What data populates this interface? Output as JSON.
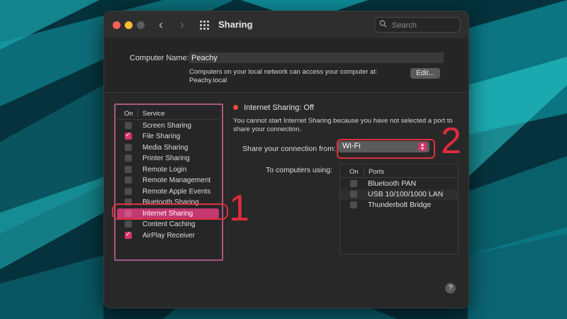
{
  "window": {
    "title": "Sharing",
    "search_placeholder": "Search"
  },
  "computer_name": {
    "label": "Computer Name:",
    "value": "Peachy",
    "description_line1": "Computers on your local network can access your computer at:",
    "description_line2": "Peachy.local",
    "edit_button": "Edit..."
  },
  "services": {
    "header_on": "On",
    "header_service": "Service",
    "items": [
      {
        "label": "Screen Sharing",
        "checked": false
      },
      {
        "label": "File Sharing",
        "checked": true
      },
      {
        "label": "Media Sharing",
        "checked": false
      },
      {
        "label": "Printer Sharing",
        "checked": false
      },
      {
        "label": "Remote Login",
        "checked": false
      },
      {
        "label": "Remote Management",
        "checked": false
      },
      {
        "label": "Remote Apple Events",
        "checked": false
      },
      {
        "label": "Bluetooth Sharing",
        "checked": false
      },
      {
        "label": "Internet Sharing",
        "checked": false,
        "selected": true
      },
      {
        "label": "Content Caching",
        "checked": false
      },
      {
        "label": "AirPlay Receiver",
        "checked": true
      }
    ]
  },
  "internet_sharing": {
    "status": "Internet Sharing: Off",
    "status_color": "#ef4b3c",
    "warning": "You cannot start Internet Sharing because you have not selected a port to share your connection.",
    "share_from_label": "Share your connection from:",
    "share_from_value": "Wi-Fi",
    "to_computers_label": "To computers using:",
    "ports_header_on": "On",
    "ports_header_ports": "Ports",
    "ports": [
      {
        "label": "Bluetooth PAN",
        "checked": false
      },
      {
        "label": "USB 10/100/1000 LAN",
        "checked": false
      },
      {
        "label": "Thunderbolt Bridge",
        "checked": false
      }
    ]
  },
  "help_button": "?",
  "annotations": {
    "marker1": "1",
    "marker2": "2",
    "color": "#e02b3c"
  },
  "icons": [
    "close-icon",
    "minimize-icon",
    "zoom-icon",
    "back-chevron-icon",
    "forward-chevron-icon",
    "grid-icon",
    "search-icon",
    "popup-arrows-icon",
    "help-icon"
  ]
}
